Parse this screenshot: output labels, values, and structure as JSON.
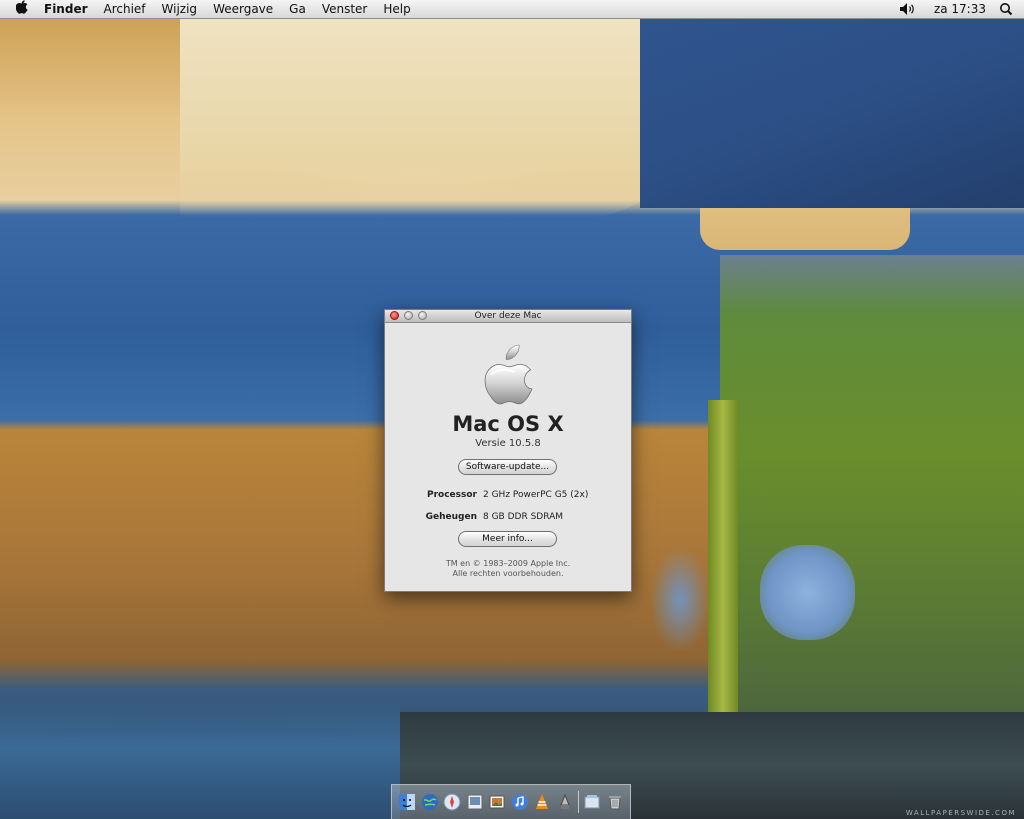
{
  "menubar": {
    "apple_icon": "apple-icon",
    "items": [
      "Finder",
      "Archief",
      "Wijzig",
      "Weergave",
      "Ga",
      "Venster",
      "Help"
    ],
    "clock": "za 17:33",
    "volume_icon": "speaker-icon",
    "spotlight_icon": "search-icon"
  },
  "about_window": {
    "title": "Over deze Mac",
    "os_name": "Mac OS X",
    "version": "Versie 10.5.8",
    "software_update_label": "Software-update...",
    "specs": [
      {
        "label": "Processor",
        "value": "2 GHz PowerPC G5 (2x)"
      },
      {
        "label": "Geheugen",
        "value": "8 GB DDR SDRAM"
      }
    ],
    "more_info_label": "Meer info...",
    "copyright_line1": "TM en © 1983–2009 Apple Inc.",
    "copyright_line2": "Alle rechten voorbehouden."
  },
  "dock": {
    "icons": [
      "finder-icon",
      "network-icon",
      "safari-icon",
      "preview-icon",
      "photos-icon",
      "itunes-icon",
      "vlc-icon",
      "ink-icon",
      "documents-icon",
      "trash-icon"
    ]
  },
  "watermark": "WALLPAPERSWIDE.COM",
  "colors": {
    "close_button": "#d01a10",
    "window_bg": "#e6e6e6",
    "menubar_bg": "#e6e6e6"
  }
}
